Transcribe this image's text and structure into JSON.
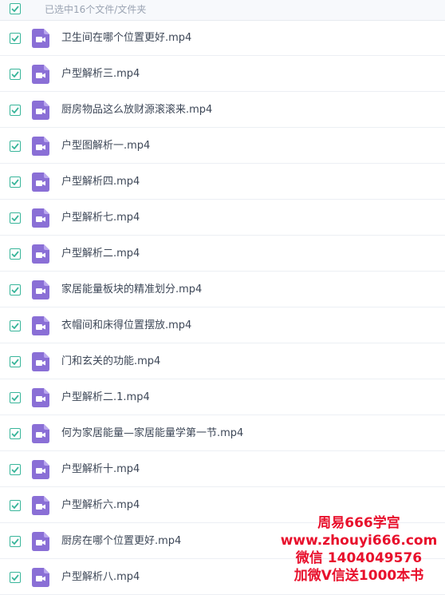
{
  "header": {
    "selection_label": "已选中16个文件/文件夹"
  },
  "files": [
    {
      "name": "卫生间在哪个位置更好.mp4",
      "checked": true,
      "icon": "video-file-icon"
    },
    {
      "name": "户型解析三.mp4",
      "checked": true,
      "icon": "video-file-icon"
    },
    {
      "name": "厨房物品这么放财源滚滚来.mp4",
      "checked": true,
      "icon": "video-file-icon"
    },
    {
      "name": "户型图解析一.mp4",
      "checked": true,
      "icon": "video-file-icon"
    },
    {
      "name": "户型解析四.mp4",
      "checked": true,
      "icon": "video-file-icon"
    },
    {
      "name": "户型解析七.mp4",
      "checked": true,
      "icon": "video-file-icon"
    },
    {
      "name": "户型解析二.mp4",
      "checked": true,
      "icon": "video-file-icon"
    },
    {
      "name": "家居能量板块的精准划分.mp4",
      "checked": true,
      "icon": "video-file-icon"
    },
    {
      "name": "衣帽间和床得位置摆放.mp4",
      "checked": true,
      "icon": "video-file-icon"
    },
    {
      "name": "门和玄关的功能.mp4",
      "checked": true,
      "icon": "video-file-icon"
    },
    {
      "name": "户型解析二.1.mp4",
      "checked": true,
      "icon": "video-file-icon"
    },
    {
      "name": "何为家居能量—家居能量学第一节.mp4",
      "checked": true,
      "icon": "video-file-icon"
    },
    {
      "name": "户型解析十.mp4",
      "checked": true,
      "icon": "video-file-icon"
    },
    {
      "name": "户型解析六.mp4",
      "checked": true,
      "icon": "video-file-icon"
    },
    {
      "name": "厨房在哪个位置更好.mp4",
      "checked": true,
      "icon": "video-file-icon"
    },
    {
      "name": "户型解析八.mp4",
      "checked": true,
      "icon": "video-file-icon"
    }
  ],
  "watermark": {
    "line1": "周易666学宫",
    "line2": "www.zhouyi666.com",
    "line3": "微信 1404049576",
    "line4": "加微V信送1000本书"
  },
  "colors": {
    "check": "#38b59a",
    "video_icon": "#8a6fd6",
    "watermark": "#e8102c"
  }
}
